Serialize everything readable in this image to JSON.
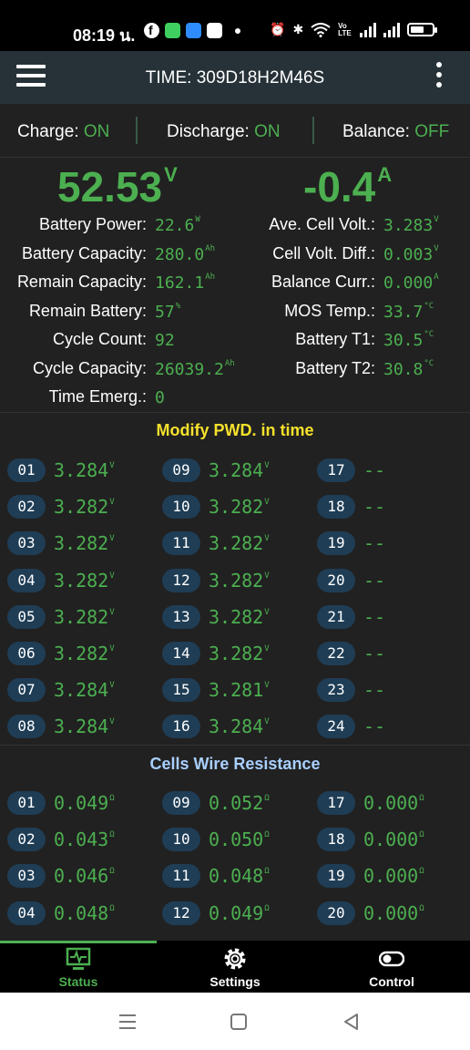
{
  "status_bar": {
    "time": "08:19 น.",
    "icons": [
      "facebook-icon",
      "line-icon",
      "app-icon",
      "gallery-icon",
      "dot-icon",
      "alarm-icon",
      "bluetooth-icon",
      "wifi-icon",
      "volte-icon",
      "signal-icon",
      "signal-icon",
      "battery-icon"
    ],
    "volte": "Vo LTE"
  },
  "app_bar": {
    "title": "TIME: 309D18H2M46S"
  },
  "switches": {
    "charge_label": "Charge:",
    "charge_value": "ON",
    "discharge_label": "Discharge:",
    "discharge_value": "ON",
    "balance_label": "Balance:",
    "balance_value": "OFF"
  },
  "summary": {
    "voltage": "52.53",
    "voltage_unit": "V",
    "current": "-0.4",
    "current_unit": "A"
  },
  "left_stats": [
    {
      "label": "Battery Power:",
      "value": "22.6",
      "unit": "W"
    },
    {
      "label": "Battery Capacity:",
      "value": "280.0",
      "unit": "Ah"
    },
    {
      "label": "Remain Capacity:",
      "value": "162.1",
      "unit": "Ah"
    },
    {
      "label": "Remain Battery:",
      "value": "57",
      "unit": "%"
    },
    {
      "label": "Cycle Count:",
      "value": "92",
      "unit": ""
    },
    {
      "label": "Cycle Capacity:",
      "value": "26039.2",
      "unit": "Ah"
    },
    {
      "label": "Time Emerg.:",
      "value": "0",
      "unit": ""
    }
  ],
  "right_stats": [
    {
      "label": "Ave. Cell Volt.:",
      "value": "3.283",
      "unit": "V"
    },
    {
      "label": "Cell Volt. Diff.:",
      "value": "0.003",
      "unit": "V"
    },
    {
      "label": "Balance Curr.:",
      "value": "0.000",
      "unit": "A"
    },
    {
      "label": "MOS Temp.:",
      "value": "33.7",
      "unit": "°C"
    },
    {
      "label": "Battery T1:",
      "value": "30.5",
      "unit": "°C"
    },
    {
      "label": "Battery T2:",
      "value": "30.8",
      "unit": "°C"
    }
  ],
  "voltages_title": "Modify PWD. in time",
  "cell_voltages": [
    {
      "id": "01",
      "value": "3.284",
      "unit": "V",
      "state": "normal"
    },
    {
      "id": "02",
      "value": "3.282",
      "unit": "V",
      "state": "max"
    },
    {
      "id": "03",
      "value": "3.282",
      "unit": "V",
      "state": "normal"
    },
    {
      "id": "04",
      "value": "3.282",
      "unit": "V",
      "state": "min"
    },
    {
      "id": "05",
      "value": "3.282",
      "unit": "V",
      "state": "normal"
    },
    {
      "id": "06",
      "value": "3.282",
      "unit": "V",
      "state": "normal"
    },
    {
      "id": "07",
      "value": "3.284",
      "unit": "V",
      "state": "normal"
    },
    {
      "id": "08",
      "value": "3.284",
      "unit": "V",
      "state": "normal"
    },
    {
      "id": "09",
      "value": "3.284",
      "unit": "V",
      "state": "normal"
    },
    {
      "id": "10",
      "value": "3.282",
      "unit": "V",
      "state": "normal"
    },
    {
      "id": "11",
      "value": "3.282",
      "unit": "V",
      "state": "normal"
    },
    {
      "id": "12",
      "value": "3.282",
      "unit": "V",
      "state": "normal"
    },
    {
      "id": "13",
      "value": "3.282",
      "unit": "V",
      "state": "normal"
    },
    {
      "id": "14",
      "value": "3.282",
      "unit": "V",
      "state": "normal"
    },
    {
      "id": "15",
      "value": "3.281",
      "unit": "V",
      "state": "normal"
    },
    {
      "id": "16",
      "value": "3.284",
      "unit": "V",
      "state": "normal"
    },
    {
      "id": "17",
      "value": "--",
      "unit": "",
      "state": "normal"
    },
    {
      "id": "18",
      "value": "--",
      "unit": "",
      "state": "normal"
    },
    {
      "id": "19",
      "value": "--",
      "unit": "",
      "state": "normal"
    },
    {
      "id": "20",
      "value": "--",
      "unit": "",
      "state": "normal"
    },
    {
      "id": "21",
      "value": "--",
      "unit": "",
      "state": "normal"
    },
    {
      "id": "22",
      "value": "--",
      "unit": "",
      "state": "normal"
    },
    {
      "id": "23",
      "value": "--",
      "unit": "",
      "state": "normal"
    },
    {
      "id": "24",
      "value": "--",
      "unit": "",
      "state": "normal"
    }
  ],
  "resistance_title": "Cells Wire Resistance",
  "wire_resistance": [
    {
      "id": "01",
      "value": "0.049",
      "unit": "Ω"
    },
    {
      "id": "02",
      "value": "0.043",
      "unit": "Ω"
    },
    {
      "id": "03",
      "value": "0.046",
      "unit": "Ω"
    },
    {
      "id": "04",
      "value": "0.048",
      "unit": "Ω"
    },
    {
      "id": "09",
      "value": "0.052",
      "unit": "Ω"
    },
    {
      "id": "10",
      "value": "0.050",
      "unit": "Ω"
    },
    {
      "id": "11",
      "value": "0.048",
      "unit": "Ω"
    },
    {
      "id": "12",
      "value": "0.049",
      "unit": "Ω"
    },
    {
      "id": "17",
      "value": "0.000",
      "unit": "Ω"
    },
    {
      "id": "18",
      "value": "0.000",
      "unit": "Ω"
    },
    {
      "id": "19",
      "value": "0.000",
      "unit": "Ω"
    },
    {
      "id": "20",
      "value": "0.000",
      "unit": "Ω"
    }
  ],
  "bottom_nav": [
    {
      "label": "Status",
      "icon": "monitor-icon",
      "active": true
    },
    {
      "label": "Settings",
      "icon": "gear-icon",
      "active": false
    },
    {
      "label": "Control",
      "icon": "toggle-icon",
      "active": false
    }
  ],
  "system_nav": [
    "menu-icon",
    "home-icon",
    "back-icon"
  ],
  "colors": {
    "accent_green": "#4caf50",
    "title_yellow": "#f5e12b",
    "title_blue": "#a9cfff",
    "max_cell_red": "#ff1d1d",
    "min_cell_blue": "#3aa0ff",
    "badge_bg": "#1f3d55",
    "app_bar_bg": "#263238"
  }
}
